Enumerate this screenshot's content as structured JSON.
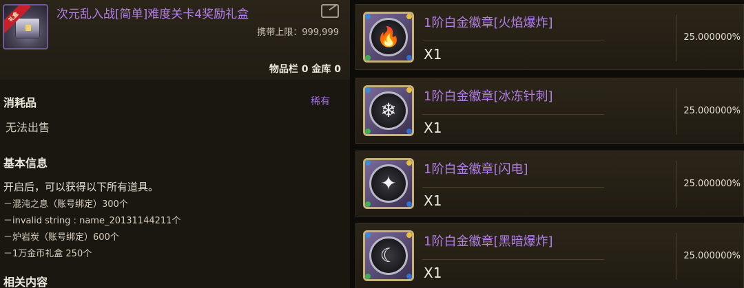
{
  "item": {
    "title": "次元乱入战[简单]难度关卡4奖励礼盒",
    "ribbon_text": "礼盒",
    "carry_limit": "携带上限：999,999",
    "storage": "物品栏 0 金库 0",
    "category": "消耗品",
    "rarity": "稀有",
    "sell_status": "无法出售"
  },
  "basic_info": {
    "title": "基本信息",
    "description": "开启后，可以获得以下所有道具。",
    "contents": [
      "－混沌之息（账号绑定）300个",
      "－invalid string : name_20131144211个",
      "－炉岩炭（账号绑定）600个",
      "－1万金币礼盒 250个"
    ]
  },
  "related": {
    "title": "相关内容"
  },
  "rewards": [
    {
      "name": "1阶白金徽章[火焰爆炸]",
      "qty": "X1",
      "rate": "25.000000%",
      "icon": "fire-icon",
      "glyph": "🔥"
    },
    {
      "name": "1阶白金徽章[冰冻针刺]",
      "qty": "X1",
      "rate": "25.000000%",
      "icon": "snowflake-icon",
      "glyph": "❄"
    },
    {
      "name": "1阶白金徽章[闪电]",
      "qty": "X1",
      "rate": "25.000000%",
      "icon": "star-burst-icon",
      "glyph": "✦"
    },
    {
      "name": "1阶白金徽章[黑暗爆炸]",
      "qty": "X1",
      "rate": "25.000000%",
      "icon": "crescent-moon-icon",
      "glyph": "☾"
    }
  ],
  "colors": {
    "item_name": "#b27fe6",
    "rarity": "#a06be0",
    "panel_bg": "#1a1610"
  }
}
